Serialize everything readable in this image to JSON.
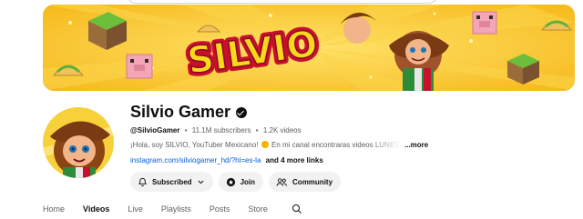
{
  "banner": {
    "logo_text": "SILVIO",
    "colors": {
      "background": "#f7c51e",
      "logo_fill": "#f3a712",
      "logo_outline": "#c8102e",
      "grass": "#6cbf3a"
    }
  },
  "channel": {
    "name": "Silvio Gamer",
    "handle": "@SilvioGamer",
    "subscribers": "11.1M subscribers",
    "videos": "1.2K videos",
    "description_before_emoji": "¡Hola, soy SILVIO, YouTuber Mexicano!",
    "description_after_emoji": "En mi canal encontraras videos LUNES, MIERCOLES",
    "description_more": "...more",
    "link_url": "instagram.com/silviogamer_hd/?hl=es-la",
    "link_more": "and 4 more links"
  },
  "actions": {
    "subscribed_label": "Subscribed",
    "join_label": "Join",
    "community_label": "Community"
  },
  "tabs": [
    {
      "label": "Home",
      "active": false
    },
    {
      "label": "Videos",
      "active": true
    },
    {
      "label": "Live",
      "active": false
    },
    {
      "label": "Playlists",
      "active": false
    },
    {
      "label": "Posts",
      "active": false
    },
    {
      "label": "Store",
      "active": false
    }
  ],
  "icons": {
    "verified": "verified-checkmark-icon",
    "bell": "bell-icon",
    "chevron": "chevron-down-icon",
    "join": "star-badge-icon",
    "community": "people-icon",
    "search": "search-icon"
  }
}
